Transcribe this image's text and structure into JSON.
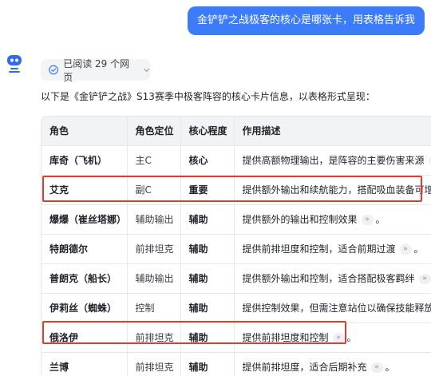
{
  "chat": {
    "user_message": "金铲铲之战极客的核心是哪张卡，用表格告诉我"
  },
  "response": {
    "sources_label": "已阅读 29 个网页",
    "intro": "以下是《金铲铲之战》S13赛季中极客阵容的核心卡片信息，以表格形式呈现：",
    "table": {
      "headers": [
        "角色",
        "角色定位",
        "核心程度",
        "作用描述"
      ],
      "rows": [
        {
          "name": "库奇（飞机）",
          "role": "主C",
          "level": "核心",
          "desc": "提供高额物理输出，是阵容的主要伤害来源",
          "cite": "»",
          "tail": "。"
        },
        {
          "name": "艾克",
          "role": "副C",
          "level": "重要",
          "desc": "提供额外输出和续航能力，搭配吸血装备可增强",
          "cite": "",
          "tail": ""
        },
        {
          "name": "爆爆（崔丝塔娜）",
          "role": "辅助输出",
          "level": "辅助",
          "desc": "提供额外的输出和控制效果",
          "cite": "»",
          "tail": "。"
        },
        {
          "name": "特朗德尔",
          "role": "前排坦克",
          "level": "辅助",
          "desc": "提供前排坦度和控制，适合前期过渡",
          "cite": "»",
          "tail": "。"
        },
        {
          "name": "普朗克（船长）",
          "role": "辅助输出",
          "level": "辅助",
          "desc": "提供额外输出和控制，适合搭配极客羁绊",
          "cite": "»",
          "tail": "。"
        },
        {
          "name": "伊莉丝（蜘蛛）",
          "role": "控制",
          "level": "辅助",
          "desc": "提供控制效果，但需注意站位以确保技能释放",
          "cite": "»",
          "tail": ""
        },
        {
          "name": "俄洛伊",
          "role": "前排坦克",
          "level": "辅助",
          "desc": "提供前排坦度和控制",
          "cite": "»",
          "tail": "。"
        },
        {
          "name": "兰博",
          "role": "前排坦克",
          "level": "辅助",
          "desc": "提供前排坦度，适合后期补充",
          "cite": "»",
          "tail": "。"
        }
      ]
    }
  },
  "colors": {
    "accent": "#3c7cfa",
    "highlight": "#e33b2e"
  },
  "icons": {
    "avatar": "bot-avatar-icon",
    "check": "check-circle-icon",
    "chevron": "chevron-down-icon"
  }
}
